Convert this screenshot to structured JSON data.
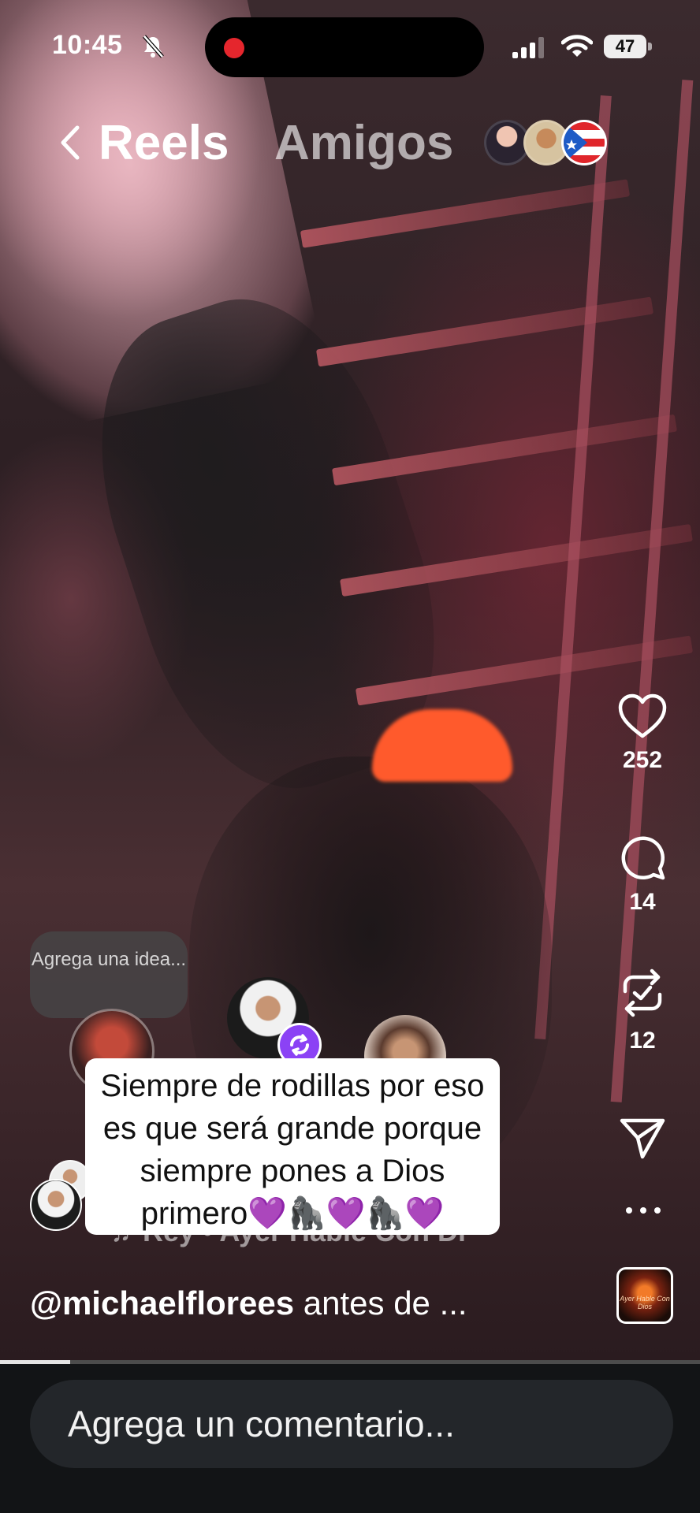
{
  "status_bar": {
    "time": "10:45",
    "battery": "47",
    "icons": [
      "bell-slash-icon",
      "cellular-signal-icon",
      "wifi-icon",
      "battery-icon"
    ],
    "recording_color": "#e5262d"
  },
  "nav": {
    "back_icon": "chevron-left-icon",
    "tab_active": "Reels",
    "tab_other": "Amigos",
    "friend_avatars": 3
  },
  "actions": {
    "likes": "252",
    "comments": "14",
    "reposts": "12",
    "icons": [
      "heart-icon",
      "comment-icon",
      "repost-icon",
      "send-icon",
      "more-icon"
    ]
  },
  "overlay": {
    "idea_prompt": "Agrega una idea...",
    "note_text": "Siempre de rodillas por eso es que será grande porque siempre pones a Dios primero💜🦍💜🦍💜",
    "audio_text": "Rey • Ayer Hable Con Di"
  },
  "caption": {
    "username": "@michaelflorees",
    "text": " antes de ..."
  },
  "audio_thumb_text": "Ayer Hable Con Dios",
  "progress": 0.1,
  "comment_box": {
    "placeholder": "Agrega un comentario..."
  },
  "colors": {
    "repost_badge": "#8b42f5",
    "background": "#121416"
  }
}
